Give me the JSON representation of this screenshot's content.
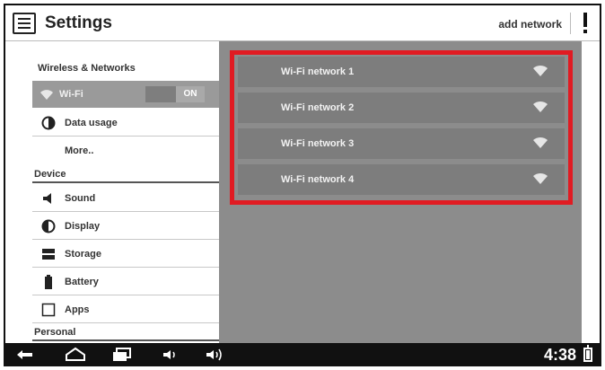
{
  "titlebar": {
    "title": "Settings",
    "add_network": "add network",
    "icon": "settings-list-icon",
    "overflow_icon": "overflow-menu-icon"
  },
  "sidebar": {
    "sections": {
      "wireless": "Wireless & Networks",
      "device": "Device",
      "personal": "Personal"
    },
    "wifi": {
      "label": "Wi-Fi",
      "toggle": "ON",
      "icon": "wifi-icon"
    },
    "items": [
      {
        "label": "Data usage",
        "icon": "data-usage-icon"
      },
      {
        "label": "More..",
        "icon": ""
      },
      {
        "label": "Sound",
        "icon": "sound-icon"
      },
      {
        "label": "Display",
        "icon": "display-icon"
      },
      {
        "label": "Storage",
        "icon": "storage-icon"
      },
      {
        "label": "Battery",
        "icon": "battery-icon"
      },
      {
        "label": "Apps",
        "icon": "apps-icon"
      }
    ]
  },
  "networks": [
    {
      "name": "Wi-Fi network 1"
    },
    {
      "name": "Wi-Fi network 2"
    },
    {
      "name": "Wi-Fi network 3"
    },
    {
      "name": "Wi-Fi network 4"
    }
  ],
  "statusbar": {
    "time": "4:38"
  },
  "colors": {
    "highlight": "#e11b22",
    "right_pane": "#8c8c8c",
    "selected_item": "#9a9a9a",
    "navbar": "#111111"
  }
}
